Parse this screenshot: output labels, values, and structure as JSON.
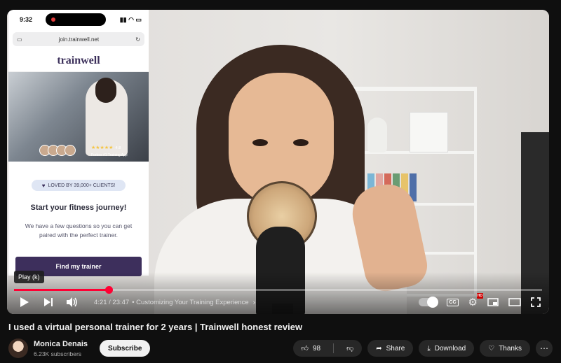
{
  "player": {
    "phone": {
      "clock": "9:32",
      "url": "join.trainwell.net",
      "brand": "trainwell",
      "rating_stars": "★★★★★",
      "rating_value": "4.8",
      "rating_source": "Forbes #1 Training App",
      "badge": "LOVED BY 39,000+ CLIENTS!",
      "headline": "Start your fitness journey!",
      "body": "We have a few questions so you can get paired with the perfect trainer.",
      "cta": "Find my trainer"
    },
    "tooltip": "Play (k)",
    "progress_fraction": 0.179,
    "time_current": "4:21",
    "time_total": "23:47",
    "time_separator": "/",
    "chapter": "• Customizing Your Training Experience",
    "cc_label": "CC",
    "hd_badge": "HD"
  },
  "video": {
    "title": "I used a virtual personal trainer for 2 years | Trainwell honest review"
  },
  "channel": {
    "name": "Monica Denais",
    "subscribers": "6.23K subscribers",
    "subscribe_label": "Subscribe"
  },
  "actions": {
    "likes": "98",
    "share": "Share",
    "download": "Download",
    "thanks": "Thanks"
  }
}
